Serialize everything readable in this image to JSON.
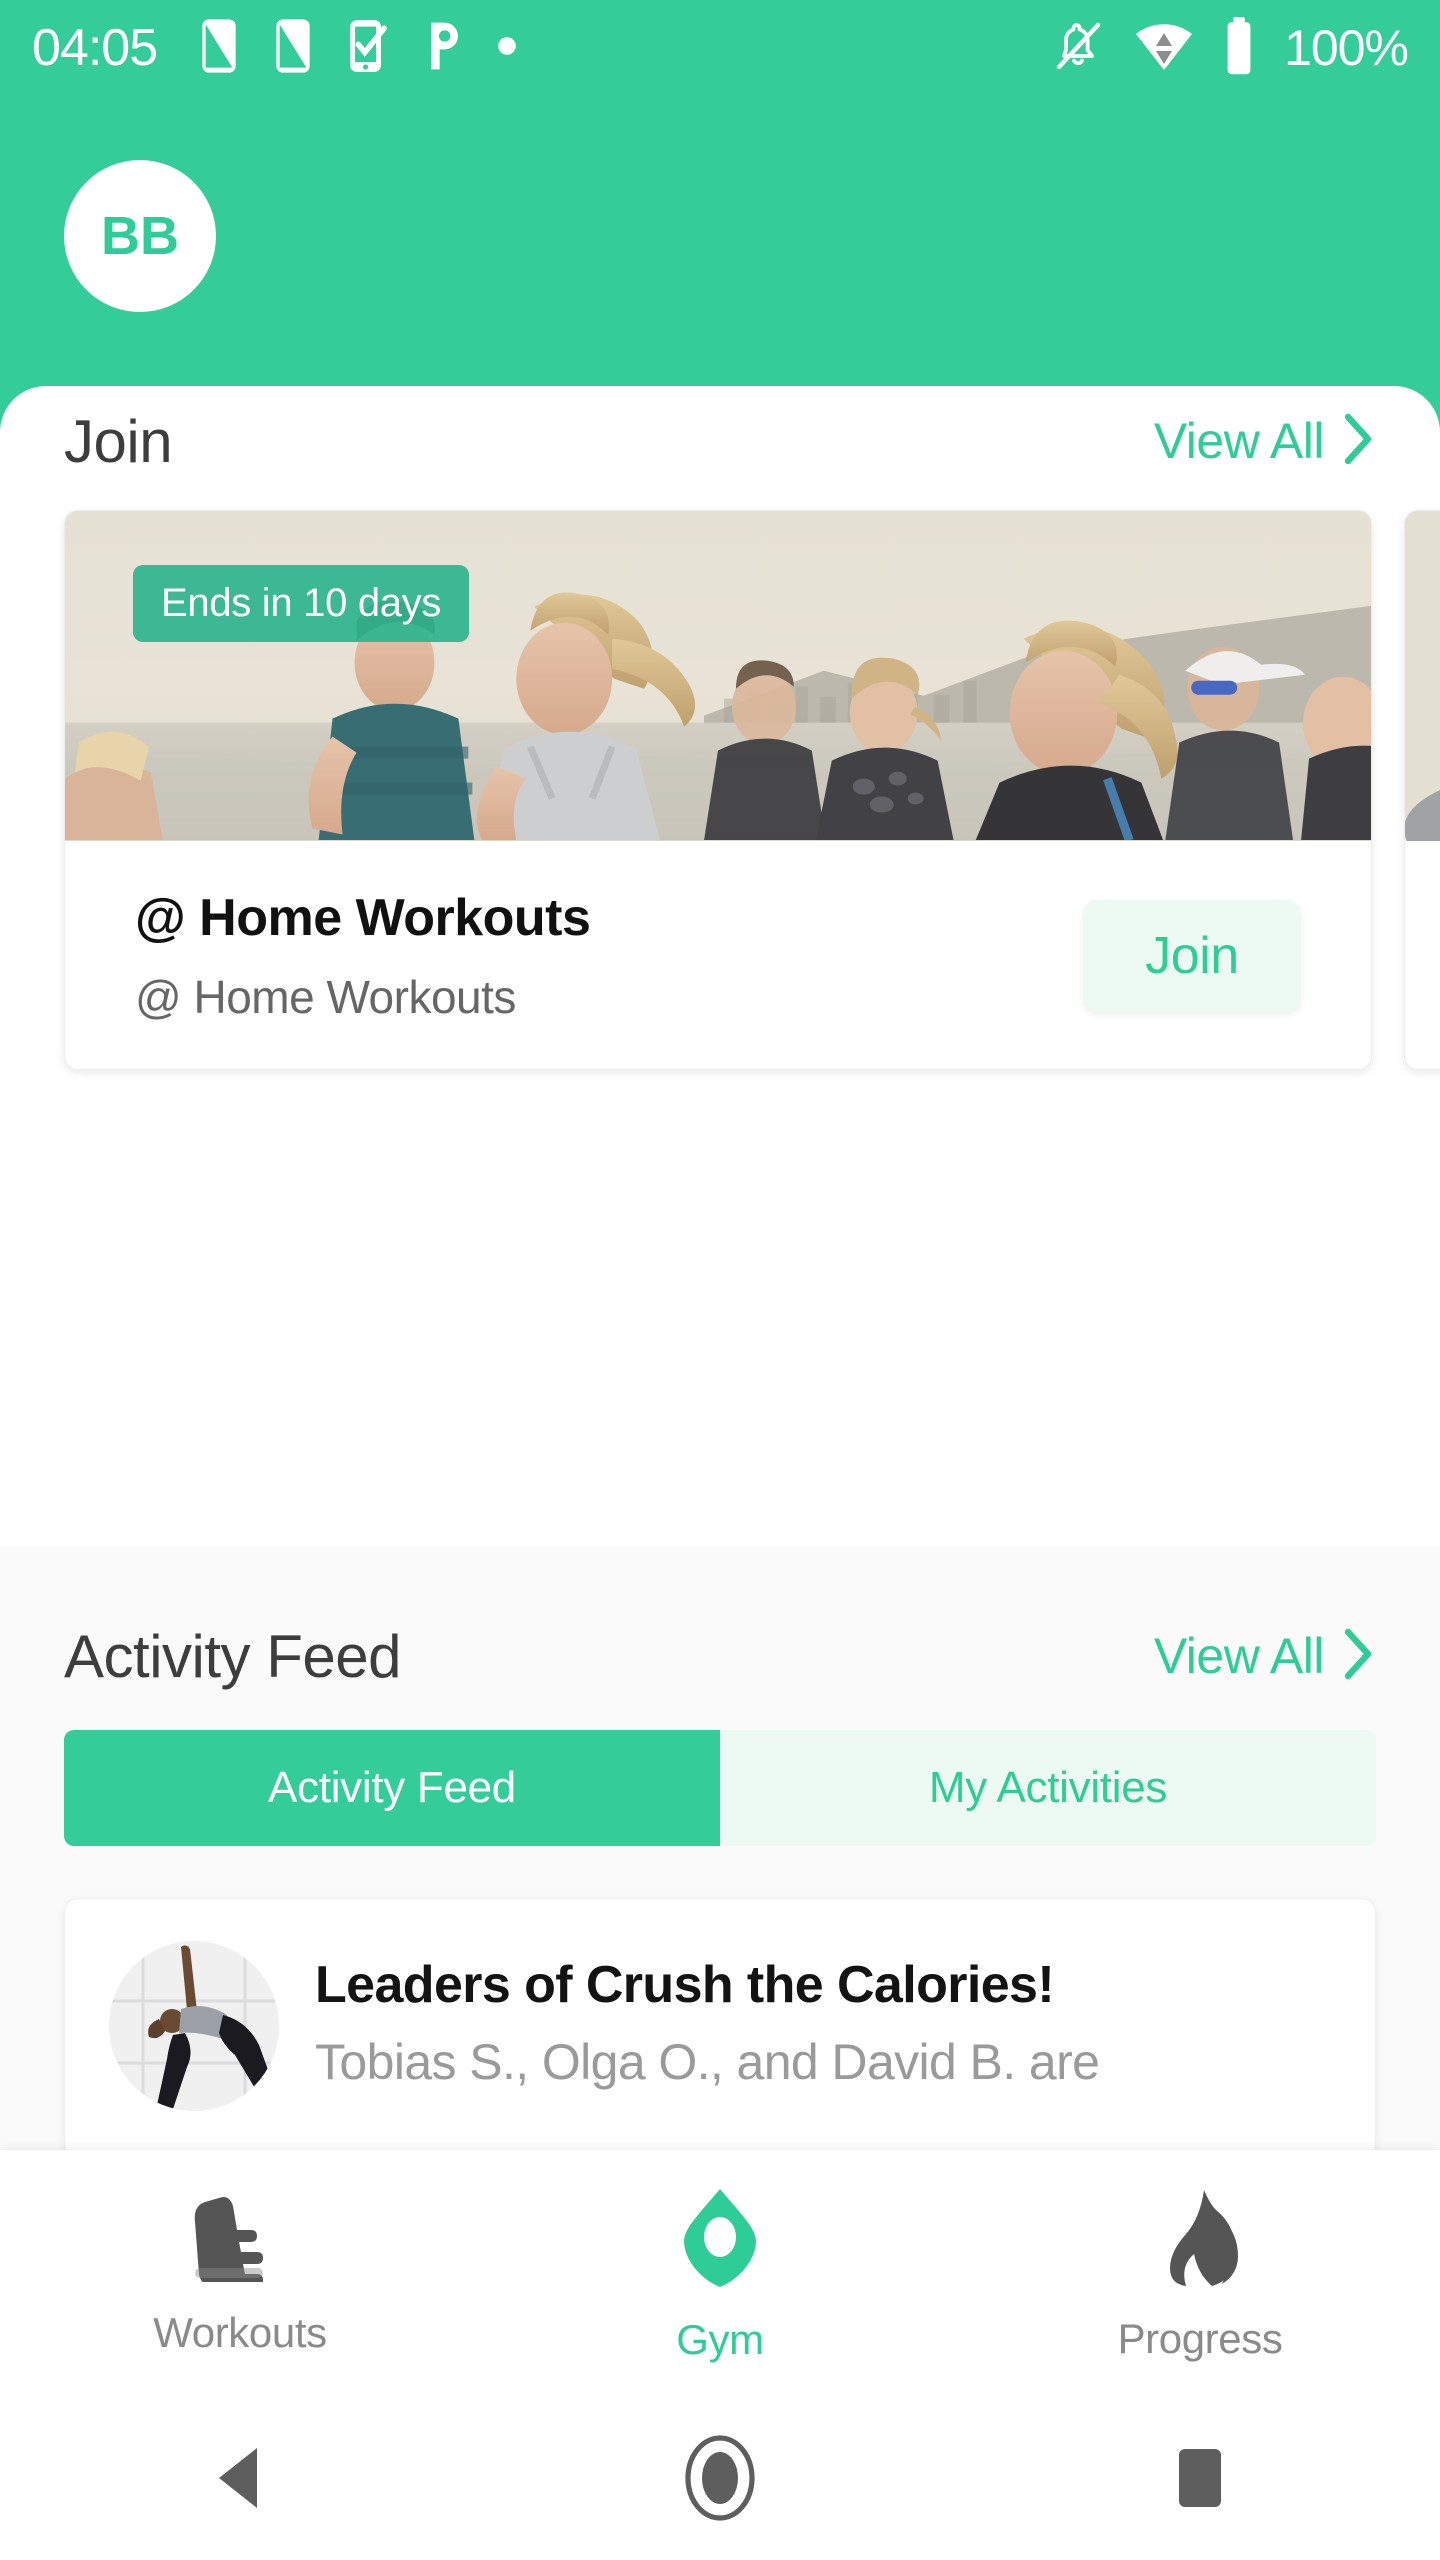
{
  "status_bar": {
    "clock": "04:05",
    "battery_text": "100%",
    "left_icons": [
      "phone-signal-icon",
      "phone-signal-icon-2",
      "phone-check-icon",
      "letter-p-icon",
      "dot-icon"
    ],
    "right_icons": [
      "notifications-off-icon",
      "wifi-icon",
      "battery-icon"
    ]
  },
  "header": {
    "avatar_initials": "BB"
  },
  "join_section": {
    "title": "Join",
    "view_all_label": "View All",
    "cards": [
      {
        "badge": "Ends in 10 days",
        "title": "@ Home Workouts",
        "subtitle": "@ Home Workouts",
        "button_label": "Join",
        "image_alt": "group-of-runners-on-beach"
      }
    ]
  },
  "activity_section": {
    "title": "Activity Feed",
    "view_all_label": "View All",
    "tabs": [
      {
        "label": "Activity Feed",
        "active": true
      },
      {
        "label": "My Activities",
        "active": false
      }
    ],
    "items": [
      {
        "title": "Leaders of Crush the Calories!",
        "subtitle": "Tobias S., Olga O., and David B. are",
        "thumb_alt": "yoga-triangle-pose"
      }
    ]
  },
  "bottom_nav": {
    "items": [
      {
        "label": "Workouts",
        "icon": "shoe-icon",
        "active": false
      },
      {
        "label": "Gym",
        "icon": "location-pin-icon",
        "active": true
      },
      {
        "label": "Progress",
        "icon": "flame-icon",
        "active": false
      }
    ]
  },
  "android_nav": {
    "items": [
      "back-icon",
      "home-icon",
      "recents-icon"
    ]
  },
  "colors": {
    "brand_green": "#34CC99",
    "accent_green": "#2ECC96",
    "mint_light": "#EDF9F3",
    "text_dark": "#3D3D3D",
    "text_muted": "#9A9A9A",
    "page_bg": "#FAFAFA"
  }
}
